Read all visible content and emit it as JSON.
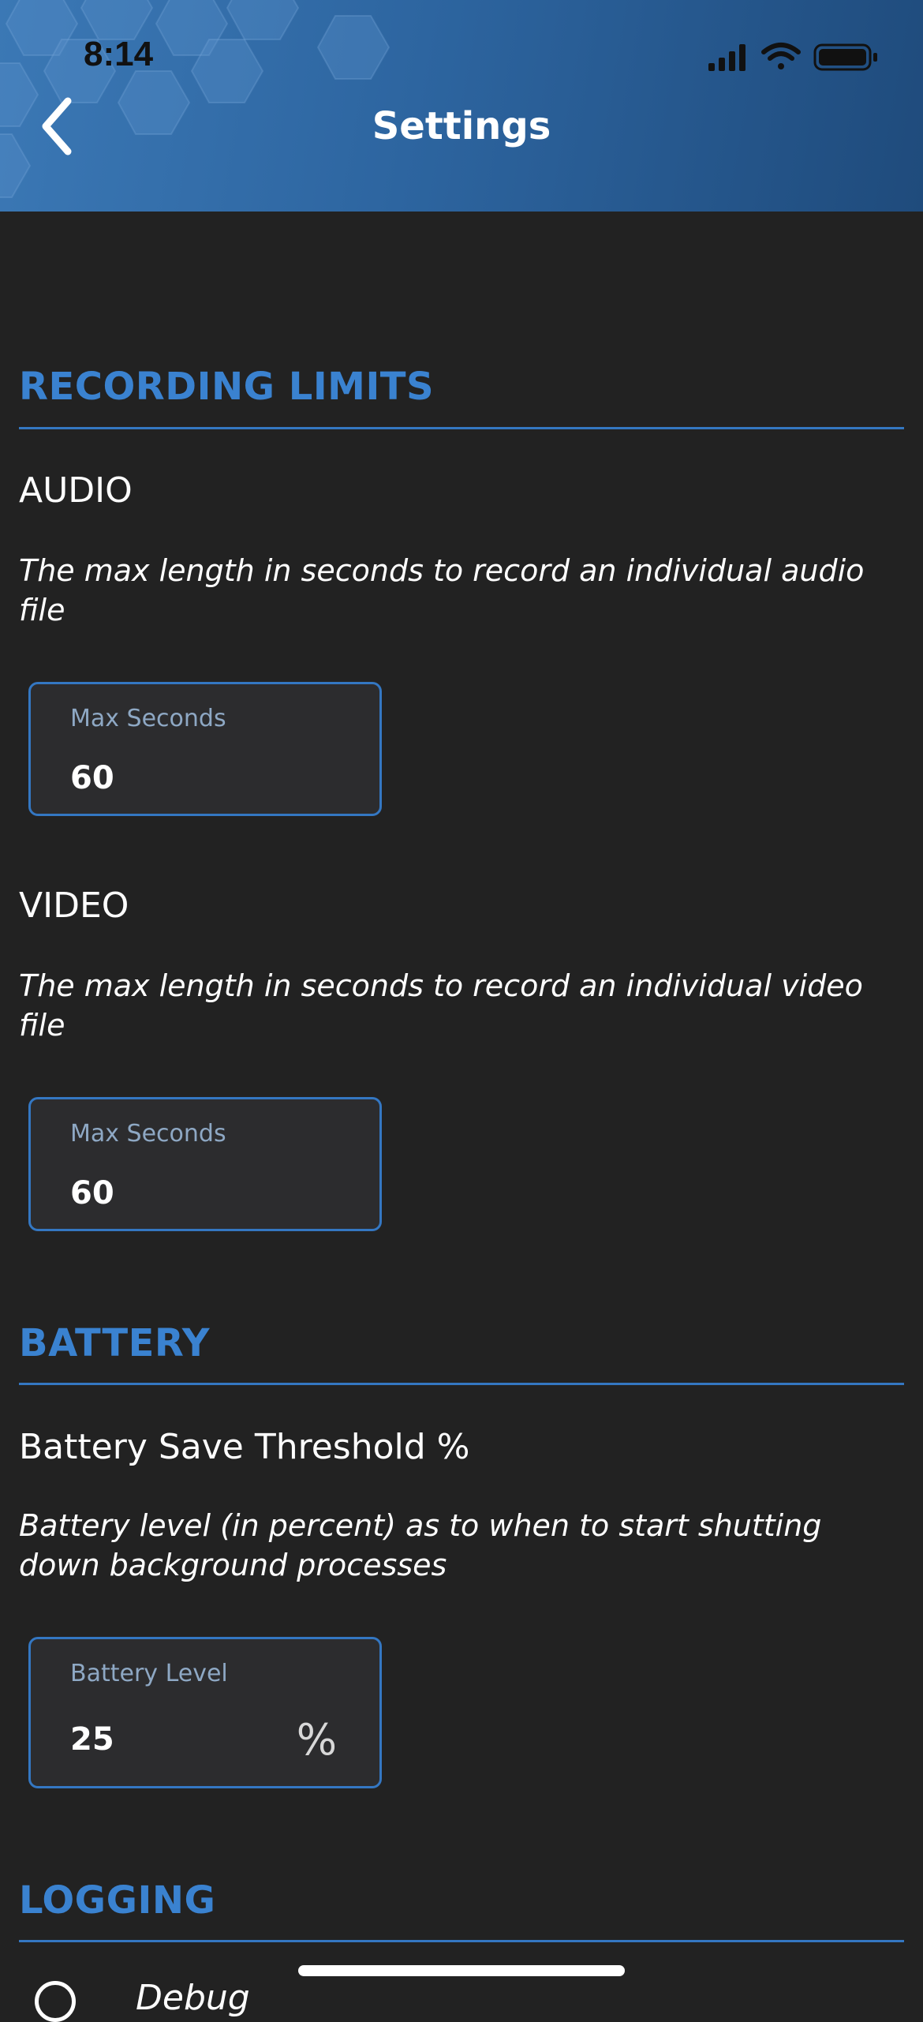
{
  "status_bar": {
    "time": "8:14"
  },
  "header": {
    "title": "Settings",
    "gradient_start": "#3b78b5",
    "gradient_end": "#1f4b7c"
  },
  "theme": {
    "background": "#222222",
    "accent": "#3a82d0",
    "field_bg": "#2c2c2e"
  },
  "sections": {
    "recording_limits": {
      "title": "RECORDING LIMITS",
      "audio": {
        "title": "AUDIO",
        "description": "The max length in seconds to record an individual audio file",
        "field_label": "Max Seconds",
        "field_value": "60"
      },
      "video": {
        "title": "VIDEO",
        "description": "The max length in seconds to record an individual video file",
        "field_label": "Max Seconds",
        "field_value": "60"
      }
    },
    "battery": {
      "title": "BATTERY",
      "threshold": {
        "title": "Battery Save Threshold %",
        "description": "Battery level (in percent) as to when to start shutting down background processes",
        "field_label": "Battery Level",
        "field_value": "25",
        "field_suffix": "%"
      }
    },
    "logging": {
      "title": "LOGGING",
      "first_option_partial": "Debug"
    }
  }
}
